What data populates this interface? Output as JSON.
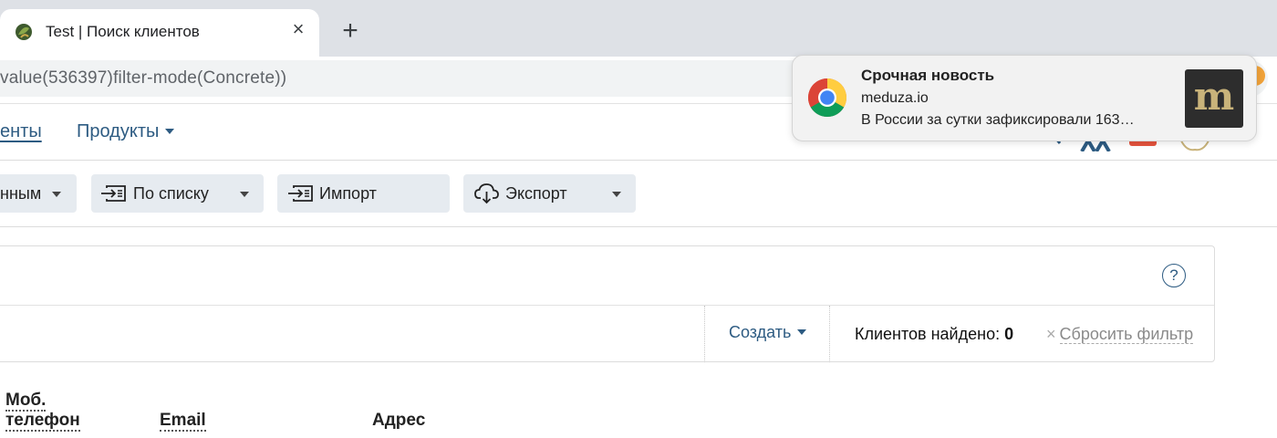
{
  "browser": {
    "tab": {
      "title": "Test | Поиск клиентов",
      "close_icon": "×",
      "favicon": "leaf-favicon-icon"
    },
    "new_tab_icon": "+",
    "address": "value(536397)filter-mode(Concrete))"
  },
  "nav": {
    "clients_label": "енты",
    "products_label": "Продукты"
  },
  "filters": [
    {
      "label": "нным",
      "icon": ""
    },
    {
      "label": "По списку",
      "icon": "list-import-icon"
    },
    {
      "label": "Импорт",
      "icon": "list-import-icon"
    },
    {
      "label": "Экспорт",
      "icon": "cloud-download-icon"
    }
  ],
  "panel": {
    "help_icon": "?",
    "create_label": "Создать",
    "found_label": "Клиентов найдено:",
    "found_count": "0",
    "reset_x": "×",
    "reset_label": "Сбросить фильтр"
  },
  "table": {
    "headers": [
      "Моб.",
      "телефон",
      "Email",
      "Адрес"
    ]
  },
  "notification": {
    "title": "Срочная новость",
    "source": "meduza.io",
    "body": "В России за сутки зафиксировали 163…",
    "thumb_letter": "m",
    "app_icon": "chrome-icon"
  },
  "colors": {
    "link": "#2d5b82",
    "button_bg": "#e6ebf0",
    "tabstrip": "#dee1e6"
  }
}
